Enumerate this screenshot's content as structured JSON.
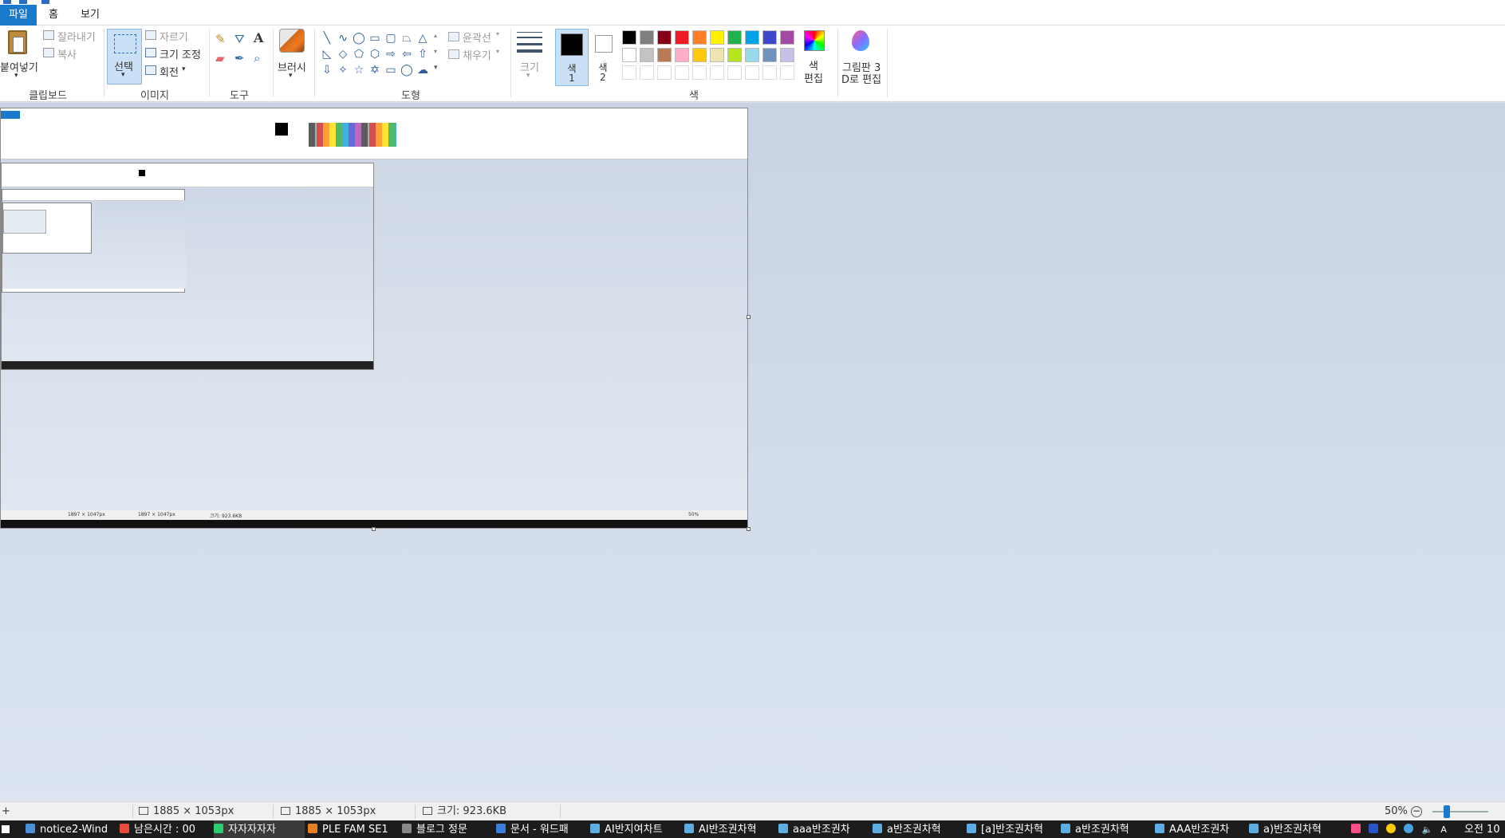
{
  "ribbon": {
    "tabs": {
      "file": "파일",
      "home": "홈",
      "view": "보기"
    },
    "clipboard": {
      "paste": "붙여넣기",
      "cut": "잘라내기",
      "copy": "복사",
      "group": "클립보드"
    },
    "image": {
      "select": "선택",
      "crop": "자르기",
      "resize": "크기 조정",
      "rotate": "회전",
      "group": "이미지"
    },
    "tools": {
      "group": "도구",
      "text_icon": "A"
    },
    "brushes": {
      "label": "브러시"
    },
    "shapes": {
      "outline": "윤곽선",
      "fill": "채우기",
      "group": "도형"
    },
    "size": {
      "label": "크기"
    },
    "colors": {
      "color1_line1": "색",
      "color1_line2": "1",
      "color2_line1": "색",
      "color2_line2": "2",
      "edit_line1": "색",
      "edit_line2": "편집",
      "paint3d_line1": "그림판 3",
      "paint3d_line2": "D로 편집",
      "group": "색",
      "palette_row1": [
        "#000000",
        "#7f7f7f",
        "#880015",
        "#ed1c24",
        "#ff7f27",
        "#fff200",
        "#22b14c",
        "#00a2e8",
        "#3f48cc",
        "#a349a4"
      ],
      "palette_row2": [
        "#ffffff",
        "#c3c3c3",
        "#b97a57",
        "#ffaec9",
        "#ffc90e",
        "#efe4b0",
        "#b5e61d",
        "#99d9ea",
        "#7092be",
        "#c8bfe7"
      ]
    }
  },
  "statusbar": {
    "cursor": "+",
    "selection_size": "1885 × 1053px",
    "image_size": "1885 × 1053px",
    "file_size": "크기: 923.6KB",
    "zoom": "50%"
  },
  "taskbar": {
    "items": [
      {
        "label": "notice2-Wind",
        "color": "#4a90d9"
      },
      {
        "label": "남은시간 : 00",
        "color": "#e74c3c"
      },
      {
        "label": "자자자자자",
        "color": "#2ecc71"
      },
      {
        "label": "PLE FAM SE1",
        "color": "#e67e22"
      },
      {
        "label": "블로그 정문",
        "color": "#888888"
      },
      {
        "label": "문서 - 워드패",
        "color": "#3b7ddd"
      },
      {
        "label": "AI반지여차트",
        "color": "#5dade2"
      },
      {
        "label": "AI반조권차혁",
        "color": "#5dade2"
      },
      {
        "label": "aaa반조권차",
        "color": "#5dade2"
      },
      {
        "label": "a반조권차혁",
        "color": "#5dade2"
      },
      {
        "label": "[a]반조권차혁",
        "color": "#5dade2"
      },
      {
        "label": "a반조권차혁",
        "color": "#5dade2"
      },
      {
        "label": "AAA반조권차",
        "color": "#5dade2"
      },
      {
        "label": "a)반조권차혁",
        "color": "#5dade2"
      }
    ],
    "clock": "오전 10"
  },
  "nested": {
    "size_a": "1897 × 1047px",
    "size_b": "1897 × 1047px",
    "file_size": "크기: 923.6KB",
    "zoom": "50%"
  }
}
